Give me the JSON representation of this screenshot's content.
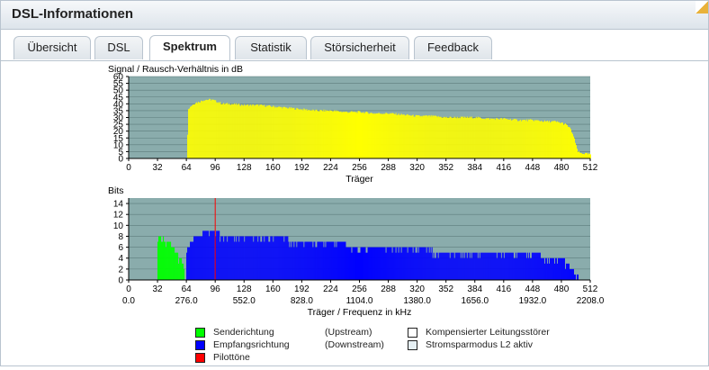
{
  "window": {
    "title": "DSL-Informationen"
  },
  "tabs": [
    {
      "label": "Übersicht",
      "active": false
    },
    {
      "label": "DSL",
      "active": false
    },
    {
      "label": "Spektrum",
      "active": true
    },
    {
      "label": "Statistik",
      "active": false
    },
    {
      "label": "Störsicherheit",
      "active": false
    },
    {
      "label": "Feedback",
      "active": false
    }
  ],
  "legend": {
    "upstream_label": "Senderichtung",
    "upstream_tag": "(Upstream)",
    "downstream_label": "Empfangsrichtung",
    "downstream_tag": "(Downstream)",
    "pilot_label": "Pilottöne",
    "crosstalk_label": "Kompensierter Leitungsstörer",
    "l2_label": "Stromsparmodus L2 aktiv"
  },
  "colors": {
    "plot_bg": "#8aacac",
    "snr": "#ffff00",
    "upstream": "#00ff00",
    "downstream": "#0000ff",
    "pilot": "#ff0000"
  },
  "chart_data": [
    {
      "type": "bar",
      "ylabel": "Signal / Rausch-Verhältnis in dB",
      "xlabel": "Träger",
      "xlim": [
        0,
        512
      ],
      "ylim": [
        0,
        60
      ],
      "xticks": [
        0,
        32,
        64,
        96,
        128,
        160,
        192,
        224,
        256,
        288,
        320,
        352,
        384,
        416,
        448,
        480,
        512
      ],
      "yticks": [
        0,
        5,
        10,
        15,
        20,
        25,
        30,
        35,
        40,
        45,
        50,
        55,
        60
      ],
      "series": [
        {
          "x": [
            64,
            66,
            68,
            70,
            72,
            74,
            76,
            80,
            84,
            88,
            92,
            96,
            100,
            104,
            108,
            112,
            128,
            144,
            160,
            176,
            192,
            208,
            224,
            240,
            256,
            272,
            288,
            304,
            320,
            336,
            352,
            368,
            384,
            400,
            416,
            432,
            448,
            464,
            472,
            480,
            484,
            488,
            490,
            492,
            494,
            496,
            498,
            500,
            512
          ],
          "values": [
            0,
            36,
            38,
            39,
            40,
            41,
            41,
            42,
            43,
            43,
            43,
            42,
            41,
            40,
            40,
            40,
            39,
            39,
            38,
            37,
            36,
            35,
            35,
            34,
            34,
            33,
            33,
            32,
            31,
            31,
            30,
            30,
            30,
            29,
            29,
            28,
            28,
            27,
            27,
            26,
            25,
            23,
            21,
            18,
            14,
            9,
            5,
            4,
            3
          ]
        }
      ]
    },
    {
      "type": "bar",
      "ylabel": "Bits",
      "xlabel": "Träger / Frequenz in kHz",
      "xlim": [
        0,
        512
      ],
      "ylim": [
        0,
        15
      ],
      "xticks": [
        0,
        32,
        64,
        96,
        128,
        160,
        192,
        224,
        256,
        288,
        320,
        352,
        384,
        416,
        448,
        480,
        512
      ],
      "freq_ticks": [
        "0.0",
        "276.0",
        "552.0",
        "828.0",
        "1104.0",
        "1380.0",
        "1656.0",
        "1932.0",
        "2208.0"
      ],
      "yticks": [
        0,
        2,
        4,
        6,
        8,
        10,
        12,
        14
      ],
      "series": [
        {
          "name": "Senderichtung",
          "x": [
            32,
            34,
            36,
            40,
            44,
            48,
            52,
            56,
            60,
            62
          ],
          "values": [
            7,
            8,
            8,
            7,
            7,
            6,
            5,
            4,
            3,
            0
          ]
        },
        {
          "name": "Empfangsrichtung",
          "x": [
            64,
            66,
            70,
            74,
            80,
            84,
            88,
            96,
            104,
            128,
            160,
            192,
            224,
            256,
            288,
            320,
            352,
            384,
            416,
            448,
            464,
            472,
            480,
            486,
            492,
            496,
            500
          ],
          "values": [
            5,
            6,
            7,
            8,
            8,
            9,
            9,
            9,
            8,
            8,
            8,
            7,
            7,
            6,
            6,
            6,
            5,
            5,
            5,
            5,
            4,
            4,
            4,
            3,
            2,
            1,
            0
          ]
        },
        {
          "name": "Pilottöne",
          "x": [
            96
          ],
          "values": [
            15
          ]
        }
      ]
    }
  ]
}
